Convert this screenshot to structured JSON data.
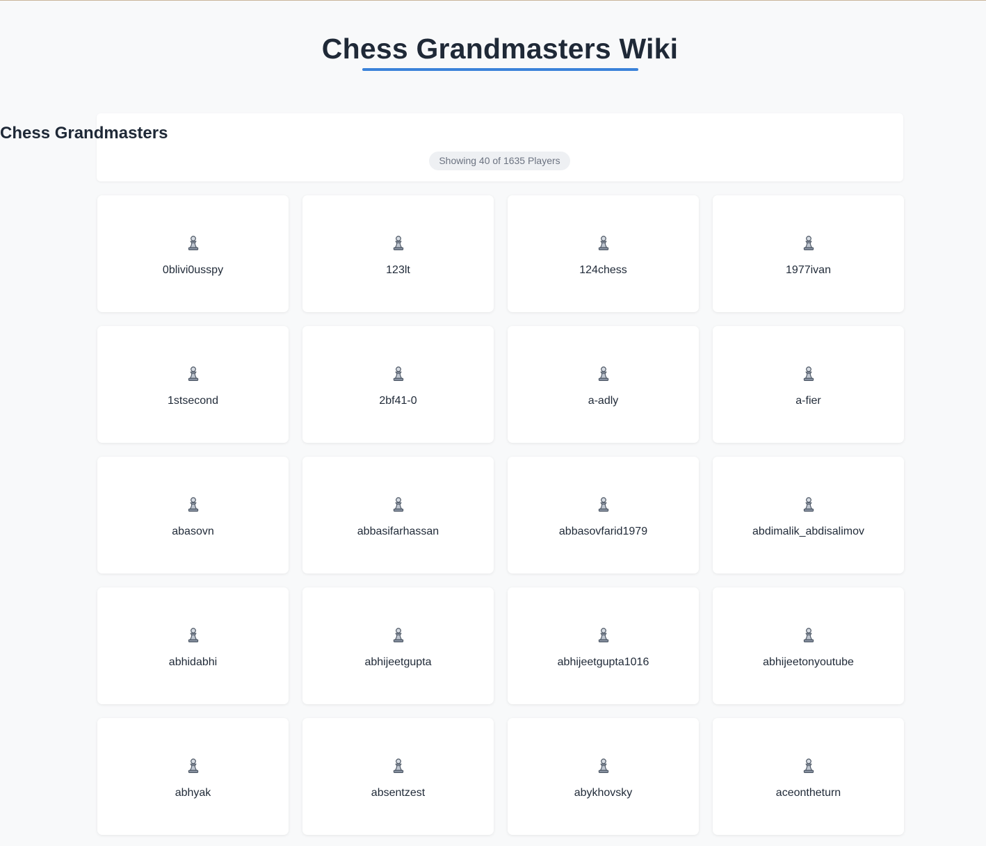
{
  "site": {
    "title": "Chess Grandmasters Wiki"
  },
  "list": {
    "title": "Chess Grandmasters",
    "count_text": "Showing 40 of 1635 Players"
  },
  "icons": {
    "player": "chess-pawn-icon"
  },
  "colors": {
    "accent": "#3b82d9",
    "background": "#f8f9fa",
    "card": "#ffffff",
    "text": "#1f2937",
    "muted": "#6b7280"
  },
  "players": [
    "0blivi0usspy",
    "123lt",
    "124chess",
    "1977ivan",
    "1stsecond",
    "2bf41-0",
    "a-adly",
    "a-fier",
    "abasovn",
    "abbasifarhassan",
    "abbasovfarid1979",
    "abdimalik_abdisalimov",
    "abhidabhi",
    "abhijeetgupta",
    "abhijeetgupta1016",
    "abhijeetonyoutube",
    "abhyak",
    "absentzest",
    "abykhovsky",
    "aceontheturn"
  ]
}
